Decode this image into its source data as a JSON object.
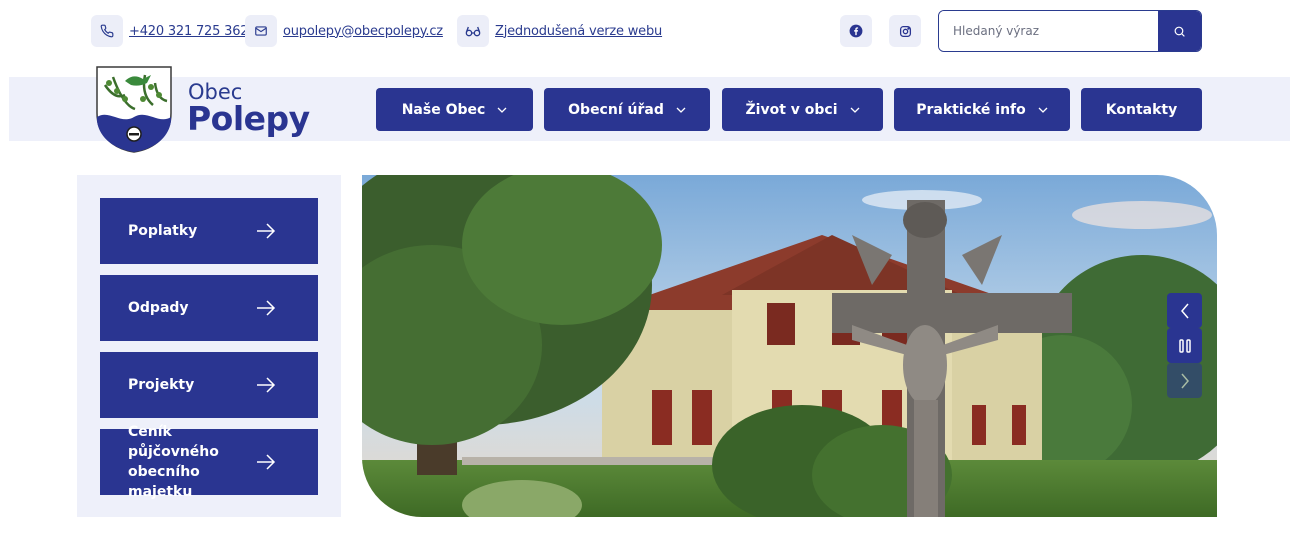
{
  "topbar": {
    "phone": {
      "icon": "phone-icon",
      "text": "+420 321 725 362"
    },
    "email": {
      "icon": "mail-icon",
      "text": "oupolepy@obecpolepy.cz"
    },
    "simple": {
      "icon": "glasses-icon",
      "text": "Zjednodušená verze webu"
    },
    "social": [
      "facebook-icon",
      "instagram-icon"
    ],
    "search": {
      "placeholder": "Hledaný výraz",
      "button_icon": "search-icon"
    }
  },
  "brand": {
    "small": "Obec",
    "big": "Polepy",
    "logo": "coat-of-arms"
  },
  "nav": {
    "items": [
      {
        "label": "Naše Obec",
        "has_dropdown": true
      },
      {
        "label": "Obecní úřad",
        "has_dropdown": true
      },
      {
        "label": "Život v obci",
        "has_dropdown": true
      },
      {
        "label": "Praktické info",
        "has_dropdown": true
      },
      {
        "label": "Kontakty",
        "has_dropdown": false
      }
    ]
  },
  "quicklinks": [
    {
      "label": "Poplatky"
    },
    {
      "label": "Odpady"
    },
    {
      "label": "Projekty"
    },
    {
      "label": "Ceník půjčovného obecního majetku"
    }
  ],
  "slider": {
    "controls": [
      "chevron-left-icon",
      "pause-icon",
      "chevron-right-icon"
    ]
  },
  "colors": {
    "primary": "#2a3591",
    "light": "#eef0fa",
    "text": "#2a3b8f"
  }
}
